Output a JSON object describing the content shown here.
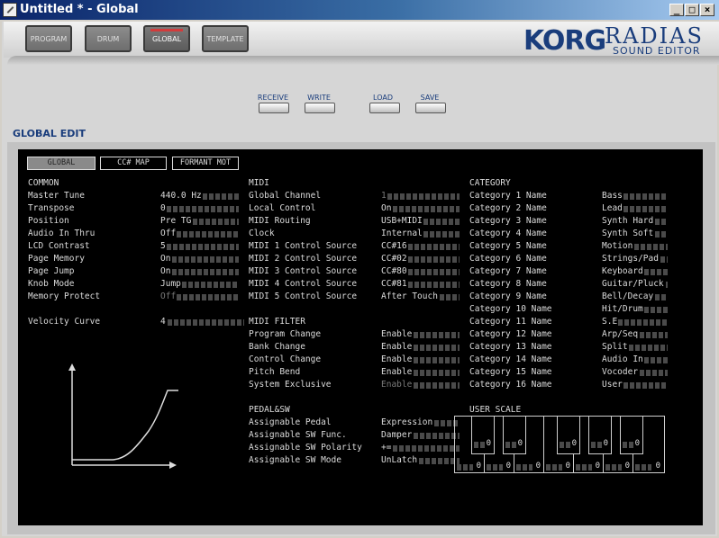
{
  "window": {
    "title": "Untitled * - Global",
    "min": "_",
    "max": "□",
    "close": "×"
  },
  "nav_tabs": [
    {
      "label": "PROGRAM",
      "active": false
    },
    {
      "label": "DRUM",
      "active": false
    },
    {
      "label": "GLOBAL",
      "active": true
    },
    {
      "label": "TEMPLATE",
      "active": false
    }
  ],
  "logo": {
    "korg": "KORG",
    "radias": "RADIAS",
    "sub": "SOUND EDITOR"
  },
  "toolbar": {
    "receive": "RECEIVE",
    "write": "WRITE",
    "load": "LOAD",
    "save": "SAVE"
  },
  "section_title": "GLOBAL EDIT",
  "panel_tabs": [
    {
      "label": "GLOBAL",
      "selected": true
    },
    {
      "label": "CC# MAP",
      "selected": false
    },
    {
      "label": "FORMANT MOT",
      "selected": false
    }
  ],
  "common": {
    "header": "COMMON",
    "rows": [
      {
        "label": "Master Tune",
        "value": "440.0 Hz",
        "dim": false
      },
      {
        "label": "Transpose",
        "value": "0",
        "dim": false
      },
      {
        "label": "Position",
        "value": "Pre TG",
        "dim": false
      },
      {
        "label": "Audio In Thru",
        "value": "Off",
        "dim": false
      },
      {
        "label": "LCD Contrast",
        "value": "5",
        "dim": false
      },
      {
        "label": "Page Memory",
        "value": "On",
        "dim": false
      },
      {
        "label": "Page Jump",
        "value": "On",
        "dim": false
      },
      {
        "label": "Knob Mode",
        "value": "Jump",
        "dim": false
      },
      {
        "label": "Memory Protect",
        "value": "Off",
        "dim": true
      }
    ],
    "velocity": {
      "label": "Velocity Curve",
      "value": "4"
    }
  },
  "midi": {
    "header": "MIDI",
    "rows": [
      {
        "label": "Global Channel",
        "value": "1",
        "dim": true
      },
      {
        "label": "Local Control",
        "value": "On",
        "dim": false
      },
      {
        "label": "MIDI Routing",
        "value": "USB+MIDI",
        "dim": false
      },
      {
        "label": "Clock",
        "value": "Internal",
        "dim": false
      },
      {
        "label": "MIDI 1 Control Source",
        "value": "CC#16",
        "dim": false
      },
      {
        "label": "MIDI 2 Control Source",
        "value": "CC#02",
        "dim": false
      },
      {
        "label": "MIDI 3 Control Source",
        "value": "CC#80",
        "dim": false
      },
      {
        "label": "MIDI 4 Control Source",
        "value": "CC#81",
        "dim": false
      },
      {
        "label": "MIDI 5 Control Source",
        "value": "After Touch",
        "dim": false
      }
    ]
  },
  "midi_filter": {
    "header": "MIDI FILTER",
    "rows": [
      {
        "label": "Program Change",
        "value": "Enable",
        "dim": false
      },
      {
        "label": "Bank Change",
        "value": "Enable",
        "dim": false
      },
      {
        "label": "Control Change",
        "value": "Enable",
        "dim": false
      },
      {
        "label": "Pitch Bend",
        "value": "Enable",
        "dim": false
      },
      {
        "label": "System Exclusive",
        "value": "Enable",
        "dim": true
      }
    ]
  },
  "pedal_sw": {
    "header": "PEDAL&SW",
    "rows": [
      {
        "label": "Assignable Pedal",
        "value": "Expression",
        "dim": false
      },
      {
        "label": "Assignable SW Func.",
        "value": "Damper",
        "dim": false
      },
      {
        "label": "Assignable SW Polarity",
        "value": "+=",
        "dim": false
      },
      {
        "label": "Assignable SW Mode",
        "value": "UnLatch",
        "dim": false
      }
    ]
  },
  "category": {
    "header": "CATEGORY",
    "rows": [
      {
        "label": "Category 1 Name",
        "value": "Bass"
      },
      {
        "label": "Category 2 Name",
        "value": "Lead"
      },
      {
        "label": "Category 3 Name",
        "value": "Synth Hard"
      },
      {
        "label": "Category 4 Name",
        "value": "Synth Soft"
      },
      {
        "label": "Category 5 Name",
        "value": "Motion"
      },
      {
        "label": "Category 6 Name",
        "value": "Strings/Pad"
      },
      {
        "label": "Category 7 Name",
        "value": "Keyboard"
      },
      {
        "label": "Category 8 Name",
        "value": "Guitar/Pluck"
      },
      {
        "label": "Category 9 Name",
        "value": "Bell/Decay"
      },
      {
        "label": "Category 10 Name",
        "value": "Hit/Drum"
      },
      {
        "label": "Category 11 Name",
        "value": "S.E"
      },
      {
        "label": "Category 12 Name",
        "value": "Arp/Seq"
      },
      {
        "label": "Category 13 Name",
        "value": "Split"
      },
      {
        "label": "Category 14 Name",
        "value": "Audio In"
      },
      {
        "label": "Category 15 Name",
        "value": "Vocoder"
      },
      {
        "label": "Category 16 Name",
        "value": "User"
      }
    ]
  },
  "user_scale": {
    "header": "USER SCALE",
    "black_keys": [
      "0",
      "0",
      "0",
      "0",
      "0"
    ],
    "white_keys": [
      "0",
      "0",
      "0",
      "0",
      "0",
      "0",
      "0"
    ]
  }
}
